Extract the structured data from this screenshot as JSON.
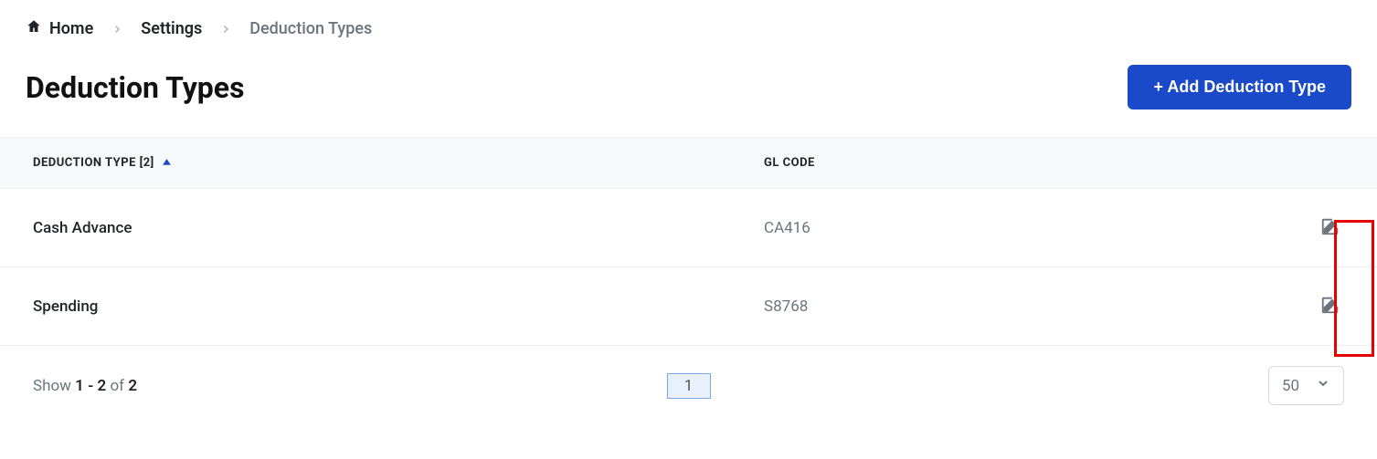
{
  "breadcrumb": {
    "home": "Home",
    "settings": "Settings",
    "current": "Deduction Types"
  },
  "page": {
    "title": "Deduction Types"
  },
  "actions": {
    "add_button": "+ Add Deduction Type"
  },
  "table": {
    "headers": {
      "name": "DEDUCTION TYPE [2]",
      "code": "GL CODE"
    },
    "rows": [
      {
        "name": "Cash Advance",
        "code": "CA416"
      },
      {
        "name": "Spending",
        "code": "S8768"
      }
    ]
  },
  "pagination": {
    "show_prefix": "Show ",
    "range": "1 - 2",
    "of": " of ",
    "total": "2",
    "current_page": "1",
    "page_size": "50"
  }
}
